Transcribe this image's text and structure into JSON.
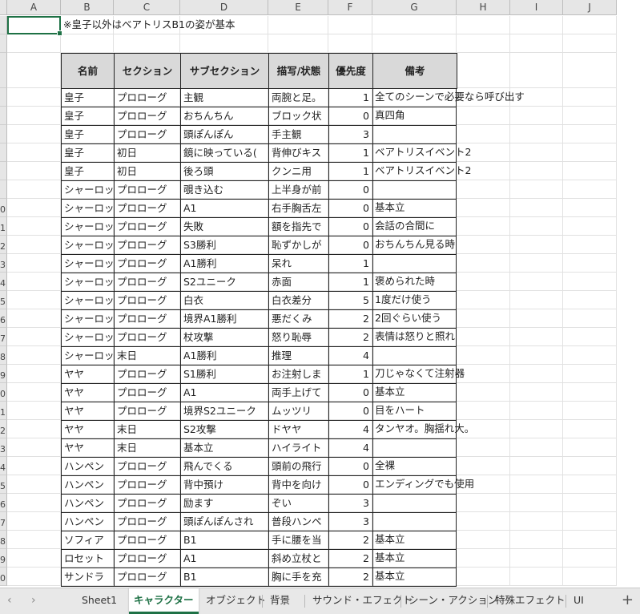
{
  "columns": [
    "A",
    "B",
    "C",
    "D",
    "E",
    "F",
    "G",
    "H",
    "I",
    "J"
  ],
  "note": "※皇子以外はベアトリスB1の姿が基本",
  "headers": [
    "名前",
    "セクション",
    "サブセクション",
    "描写/状態",
    "優先度",
    "備考"
  ],
  "rows": [
    {
      "rownum": "",
      "name": "皇子",
      "section": "プロローグ",
      "subsection": "主観",
      "desc": "両腕と足。",
      "priority": "1",
      "note": "全てのシーンで必要なら呼び出す"
    },
    {
      "rownum": "",
      "name": "皇子",
      "section": "プロローグ",
      "subsection": "おちんちん",
      "desc": "ブロック状",
      "priority": "0",
      "note": "真四角"
    },
    {
      "rownum": "",
      "name": "皇子",
      "section": "プロローグ",
      "subsection": "頭ぽんぽん",
      "desc": "手主観",
      "priority": "3",
      "note": ""
    },
    {
      "rownum": "",
      "name": "皇子",
      "section": "初日",
      "subsection": "鏡に映っている(",
      "desc": "背伸びキス",
      "priority": "1",
      "note": "ベアトリスイベント2"
    },
    {
      "rownum": "",
      "name": "皇子",
      "section": "初日",
      "subsection": "後ろ頭",
      "desc": "クンニ用",
      "priority": "1",
      "note": "ベアトリスイベント2"
    },
    {
      "rownum": "",
      "name": "シャーロッ",
      "section": "プロローグ",
      "subsection": "覗き込む",
      "desc": "上半身が前",
      "priority": "0",
      "note": ""
    },
    {
      "rownum": "0",
      "name": "シャーロッ",
      "section": "プロローグ",
      "subsection": "A1",
      "desc": "右手胸舌左",
      "priority": "0",
      "note": "基本立"
    },
    {
      "rownum": "1",
      "name": "シャーロッ",
      "section": "プロローグ",
      "subsection": "失敗",
      "desc": "額を指先で",
      "priority": "0",
      "note": "会話の合間に"
    },
    {
      "rownum": "2",
      "name": "シャーロッ",
      "section": "プロローグ",
      "subsection": "S3勝利",
      "desc": "恥ずかしが",
      "priority": "0",
      "note": "おちんちん見る時"
    },
    {
      "rownum": "3",
      "name": "シャーロッ",
      "section": "プロローグ",
      "subsection": "A1勝利",
      "desc": "呆れ",
      "priority": "1",
      "note": ""
    },
    {
      "rownum": "4",
      "name": "シャーロッ",
      "section": "プロローグ",
      "subsection": "S2ユニーク",
      "desc": "赤面",
      "priority": "1",
      "note": "褒められた時"
    },
    {
      "rownum": "5",
      "name": "シャーロッ",
      "section": "プロローグ",
      "subsection": "白衣",
      "desc": "白衣差分",
      "priority": "5",
      "note": "1度だけ使う"
    },
    {
      "rownum": "6",
      "name": "シャーロッ",
      "section": "プロローグ",
      "subsection": "境界A1勝利",
      "desc": "悪だくみ",
      "priority": "2",
      "note": "2回ぐらい使う"
    },
    {
      "rownum": "7",
      "name": "シャーロッ",
      "section": "プロローグ",
      "subsection": "杖攻撃",
      "desc": "怒り恥辱",
      "priority": "2",
      "note": "表情は怒りと照れ"
    },
    {
      "rownum": "8",
      "name": "シャーロッ",
      "section": "末日",
      "subsection": "A1勝利",
      "desc": "推理",
      "priority": "4",
      "note": ""
    },
    {
      "rownum": "9",
      "name": "ヤヤ",
      "section": "プロローグ",
      "subsection": "S1勝利",
      "desc": "お注射しま",
      "priority": "1",
      "note": "刀じゃなくて注射器"
    },
    {
      "rownum": "0",
      "name": "ヤヤ",
      "section": "プロローグ",
      "subsection": "A1",
      "desc": "両手上げて",
      "priority": "0",
      "note": "基本立"
    },
    {
      "rownum": "1",
      "name": "ヤヤ",
      "section": "プロローグ",
      "subsection": "境界S2ユニーク",
      "desc": "ムッツリ",
      "priority": "0",
      "note": "目をハート"
    },
    {
      "rownum": "2",
      "name": "ヤヤ",
      "section": "末日",
      "subsection": "S2攻撃",
      "desc": "ドヤヤ",
      "priority": "4",
      "note": "タンヤオ。胸揺れ大。"
    },
    {
      "rownum": "3",
      "name": "ヤヤ",
      "section": "末日",
      "subsection": "基本立",
      "desc": "ハイライト",
      "priority": "4",
      "note": ""
    },
    {
      "rownum": "4",
      "name": "ハンペン",
      "section": "プロローグ",
      "subsection": "飛んでくる",
      "desc": "頭前の飛行",
      "priority": "0",
      "note": "全裸"
    },
    {
      "rownum": "5",
      "name": "ハンペン",
      "section": "プロローグ",
      "subsection": "背中預け",
      "desc": "背中を向け",
      "priority": "0",
      "note": "エンディングでも使用"
    },
    {
      "rownum": "6",
      "name": "ハンペン",
      "section": "プロローグ",
      "subsection": "励ます",
      "desc": "ぞい",
      "priority": "3",
      "note": ""
    },
    {
      "rownum": "7",
      "name": "ハンペン",
      "section": "プロローグ",
      "subsection": "頭ぽんぽんされ",
      "desc": "普段ハンペ",
      "priority": "3",
      "note": ""
    },
    {
      "rownum": "8",
      "name": "ソフィア",
      "section": "プロローグ",
      "subsection": "B1",
      "desc": "手に腰を当",
      "priority": "2",
      "note": "基本立"
    },
    {
      "rownum": "9",
      "name": "ロセット",
      "section": "プロローグ",
      "subsection": "A1",
      "desc": "斜め立杖と",
      "priority": "2",
      "note": "基本立"
    },
    {
      "rownum": "0",
      "name": "サンドラ",
      "section": "プロローグ",
      "subsection": "B1",
      "desc": "胸に手を充",
      "priority": "2",
      "note": "基本立"
    }
  ],
  "tabs": [
    "Sheet1",
    "キャラクター",
    "オブジェクト",
    "背景",
    "サウンド・エフェクト",
    "シーン・アクション",
    "特殊エフェクト",
    "UI"
  ],
  "active_tab": "キャラクター",
  "colors": {
    "accent": "#1e7145",
    "header_fill": "#d9d9d9"
  }
}
